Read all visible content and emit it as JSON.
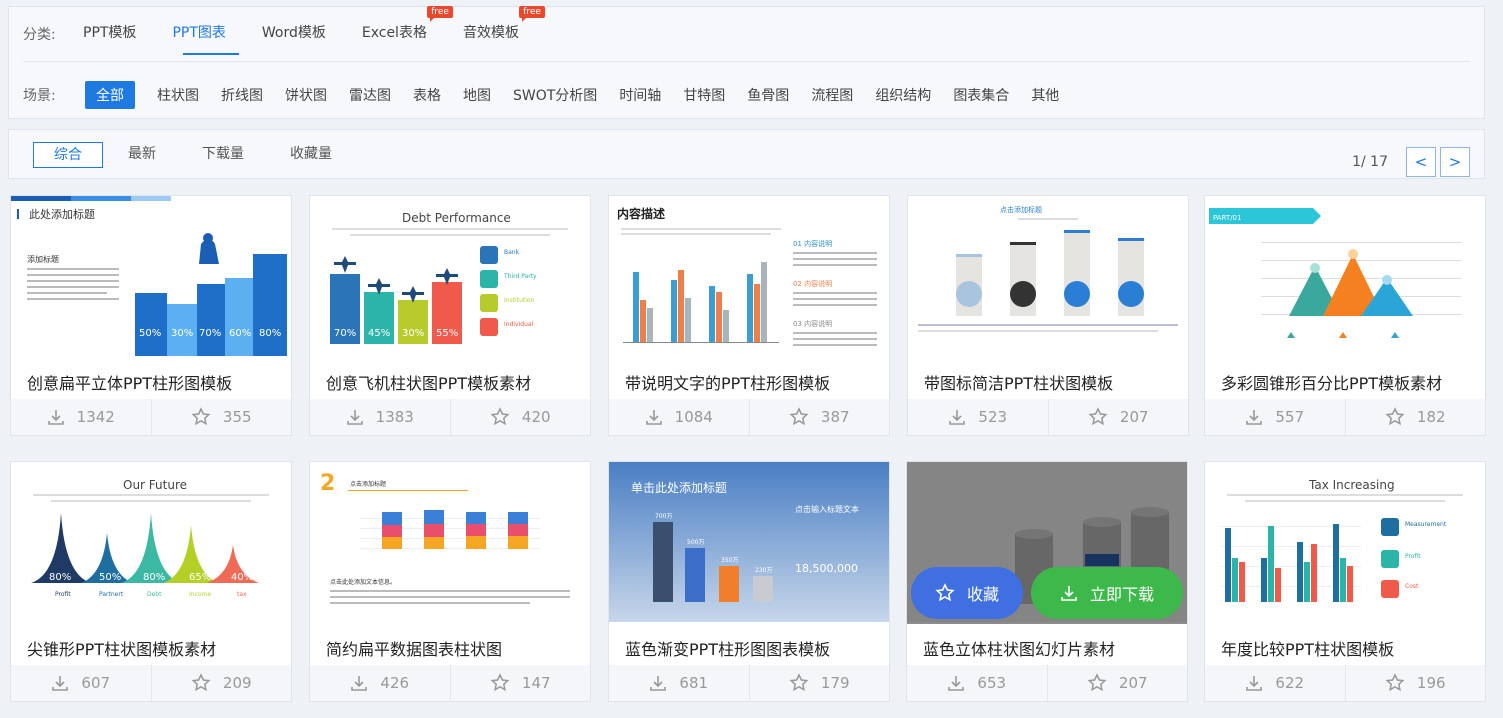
{
  "filters": {
    "category_label": "分类:",
    "categories": [
      {
        "label": "PPT模板",
        "active": false,
        "free": false
      },
      {
        "label": "PPT图表",
        "active": true,
        "free": false
      },
      {
        "label": "Word模板",
        "active": false,
        "free": false
      },
      {
        "label": "Excel表格",
        "active": false,
        "free": true
      },
      {
        "label": "音效模板",
        "active": false,
        "free": true
      }
    ],
    "free_badge": "free",
    "scene_label": "场景:",
    "scenes": [
      "全部",
      "柱状图",
      "折线图",
      "饼状图",
      "雷达图",
      "表格",
      "地图",
      "SWOT分析图",
      "时间轴",
      "甘特图",
      "鱼骨图",
      "流程图",
      "组织结构",
      "图表集合",
      "其他"
    ]
  },
  "sort": {
    "options": [
      "综合",
      "最新",
      "下载量",
      "收藏量"
    ],
    "pager_text": "1/ 17",
    "prev": "<",
    "next": ">"
  },
  "cards": [
    {
      "title": "创意扁平立体PPT柱形图模板",
      "downloads": "1342",
      "favorites": "355",
      "thumb_text": "此处添加标题",
      "thumb_sub": "添加标题",
      "bar_labels": [
        "50%",
        "30%",
        "70%",
        "60%",
        "80%"
      ]
    },
    {
      "title": "创意飞机柱状图PPT模板素材",
      "downloads": "1383",
      "favorites": "420",
      "thumb_text": "Debt Performance",
      "bar_labels": [
        "70%",
        "45%",
        "30%",
        "55%"
      ],
      "legend": [
        "Bank",
        "Third Party",
        "Institution",
        "Individual"
      ]
    },
    {
      "title": "带说明文字的PPT柱形图模板",
      "downloads": "1084",
      "favorites": "387",
      "thumb_text": "内容描述",
      "notes": [
        "01 内容说明",
        "02 内容说明",
        "03 内容说明"
      ]
    },
    {
      "title": "带图标简洁PPT柱状图模板",
      "downloads": "523",
      "favorites": "207",
      "thumb_text": "点击添加标题"
    },
    {
      "title": "多彩圆锥形百分比PPT模板素材",
      "downloads": "557",
      "favorites": "182",
      "thumb_text": "PART/01"
    },
    {
      "title": "尖锥形PPT柱状图模板素材",
      "downloads": "607",
      "favorites": "209",
      "thumb_text": "Our Future",
      "bar_labels": [
        "80%",
        "50%",
        "80%",
        "65%",
        "40%"
      ],
      "categories": [
        "Profit",
        "Partnert",
        "Debt",
        "Income",
        "tax"
      ]
    },
    {
      "title": "简约扁平数据图表柱状图",
      "downloads": "426",
      "favorites": "147",
      "thumb_text": "点击添加标题",
      "thumb_sub": "点击此处添加文本信息。"
    },
    {
      "title": "蓝色渐变PPT柱形图图表模板",
      "downloads": "681",
      "favorites": "179",
      "thumb_text": "单击此处添加标题",
      "thumb_sub": "点击输入标题文本",
      "big_number": "18,500,000",
      "bar_labels": [
        "700万",
        "500万",
        "350万",
        "230万"
      ]
    },
    {
      "title": "蓝色立体柱状图幻灯片素材",
      "downloads": "653",
      "favorites": "207",
      "overlay": {
        "fav": "收藏",
        "download": "立即下载"
      }
    },
    {
      "title": "年度比较PPT柱状图模板",
      "downloads": "622",
      "favorites": "196",
      "thumb_text": "Tax Increasing",
      "legend": [
        "Measurement",
        "Profit",
        "Cost"
      ]
    }
  ],
  "colors": {
    "accent": "#1e7ae0",
    "free_badge": "#e8482b",
    "download_green": "#3db84a",
    "fav_blue": "#3f6fe0"
  }
}
